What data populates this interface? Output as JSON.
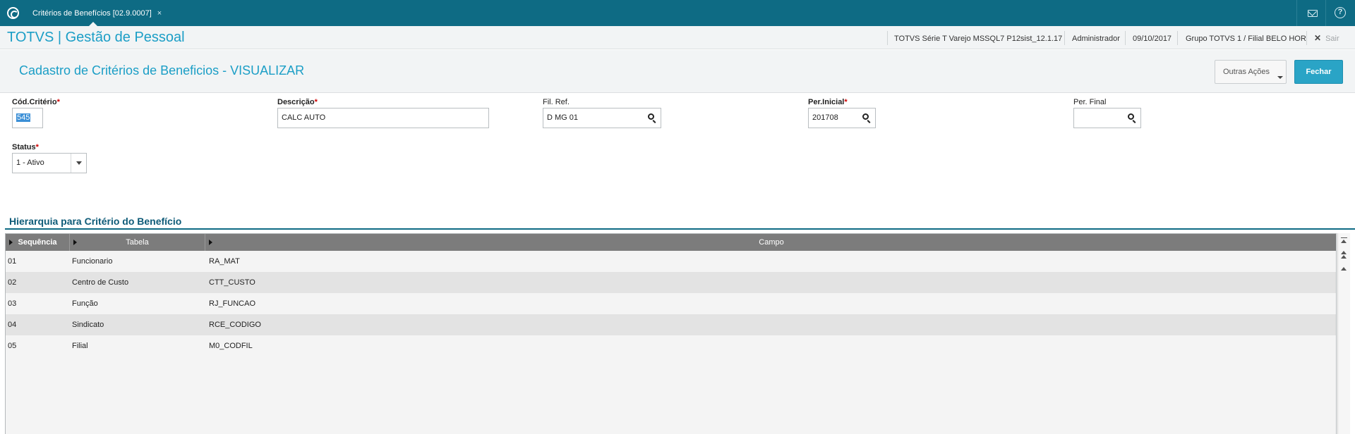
{
  "tab": {
    "title": "Critérios de Benefícios [02.9.0007]",
    "close": "×"
  },
  "header": {
    "app_title": "TOTVS | Gestão de Pessoal",
    "environment": "TOTVS Série T Varejo MSSQL7 P12sist_12.1.17",
    "user": "Administrador",
    "date": "09/10/2017",
    "company": "Grupo TOTVS 1 / Filial BELO HOR",
    "exit_label": "Sair",
    "exit_icon": "✕"
  },
  "page": {
    "title": "Cadastro de Critérios de Beneficios - VISUALIZAR",
    "outras_acoes_label": "Outras Ações",
    "fechar_label": "Fechar"
  },
  "form": {
    "cod_criterio": {
      "label": "Cód.Critério",
      "value": "545"
    },
    "descricao": {
      "label": "Descrição",
      "value": "CALC AUTO"
    },
    "fil_ref": {
      "label": "Fil. Ref.",
      "value": "D MG 01"
    },
    "per_inicial": {
      "label": "Per.Inicial",
      "value": "201708"
    },
    "per_final": {
      "label": "Per. Final",
      "value": ""
    },
    "status": {
      "label": "Status",
      "value": "1 - Ativo"
    },
    "required_mark": "*"
  },
  "grid": {
    "section_title": "Hierarquia para Critério do Benefício",
    "columns": [
      "Sequência",
      "Tabela",
      "Campo"
    ],
    "rows": [
      {
        "seq": "01",
        "tabela": "Funcionario",
        "campo": "RA_MAT"
      },
      {
        "seq": "02",
        "tabela": "Centro de Custo",
        "campo": "CTT_CUSTO"
      },
      {
        "seq": "03",
        "tabela": "Função",
        "campo": "RJ_FUNCAO"
      },
      {
        "seq": "04",
        "tabela": "Sindicato",
        "campo": "RCE_CODIGO"
      },
      {
        "seq": "05",
        "tabela": "Filial",
        "campo": "M0_CODFIL"
      }
    ]
  },
  "colors": {
    "brand": "#0e6b84",
    "accent": "#1b9ec6",
    "primary_button": "#2aa4c6",
    "required": "#d00000"
  }
}
